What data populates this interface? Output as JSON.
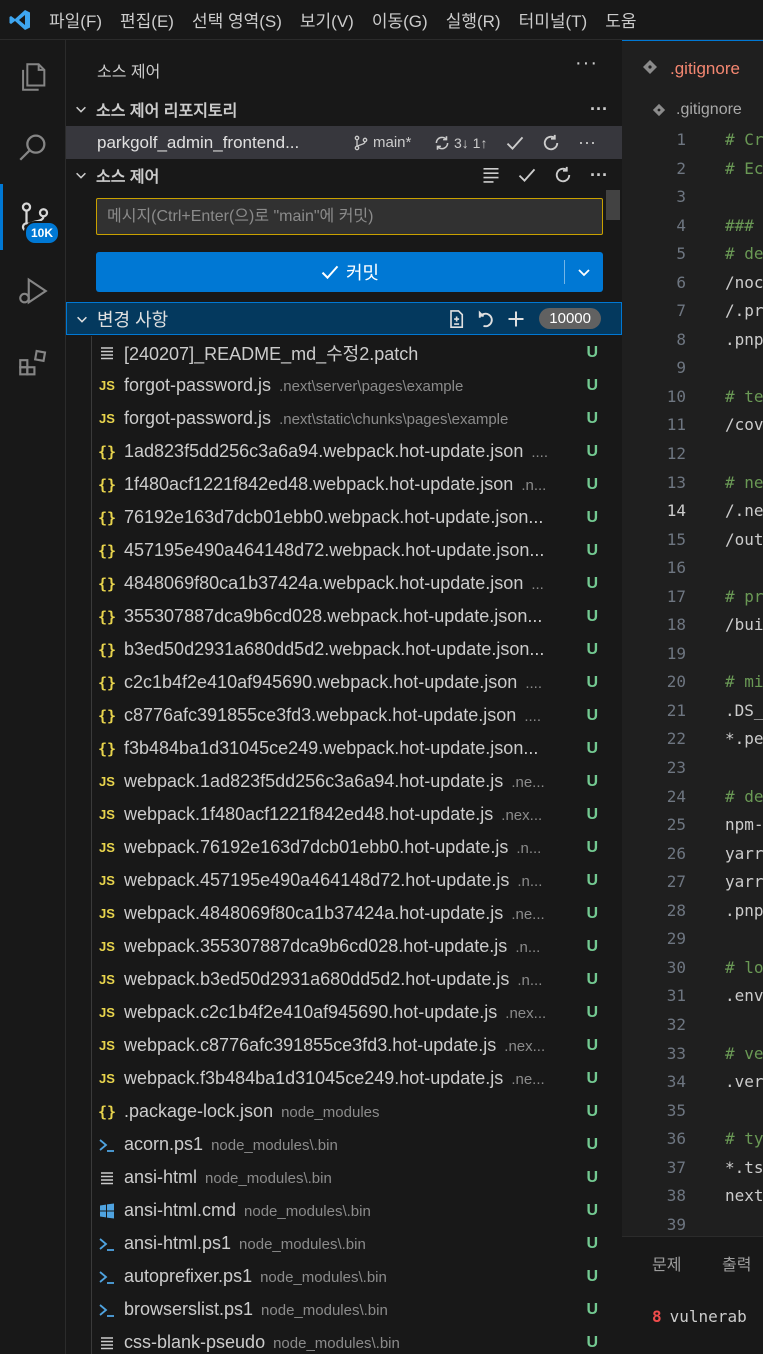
{
  "menubar": {
    "items": [
      "파일(F)",
      "편집(E)",
      "선택 영역(S)",
      "보기(V)",
      "이동(G)",
      "실행(R)",
      "터미널(T)",
      "도움"
    ]
  },
  "activity": {
    "badge": "10K",
    "accent": "#0078d4"
  },
  "sidebar": {
    "title": "소스 제어",
    "more": "···",
    "repos_header": "소스 제어 리포지토리",
    "repo": {
      "name": "parkgolf_admin_frontend...",
      "branch": "main*",
      "sync": "3↓ 1↑"
    },
    "scm_header": "소스 제어",
    "commit_placeholder": "메시지(Ctrl+Enter(으)로 \"main\"에 커밋)",
    "commit_label": "커밋",
    "changes_header": "변경 사항",
    "changes_count": "10000"
  },
  "files": [
    {
      "icon": "lines",
      "name": "[240207]_README_md_수정2.patch",
      "path": "",
      "status": "U"
    },
    {
      "icon": "js",
      "name": "forgot-password.js",
      "path": ".next\\server\\pages\\example",
      "status": "U"
    },
    {
      "icon": "js",
      "name": "forgot-password.js",
      "path": ".next\\static\\chunks\\pages\\example",
      "status": "U"
    },
    {
      "icon": "json",
      "name": "1ad823f5dd256c3a6a94.webpack.hot-update.json",
      "path": "....",
      "status": "U"
    },
    {
      "icon": "json",
      "name": "1f480acf1221f842ed48.webpack.hot-update.json",
      "path": ".n...",
      "status": "U"
    },
    {
      "icon": "json",
      "name": "76192e163d7dcb01ebb0.webpack.hot-update.json...",
      "path": "",
      "status": "U"
    },
    {
      "icon": "json",
      "name": "457195e490a464148d72.webpack.hot-update.json...",
      "path": "",
      "status": "U"
    },
    {
      "icon": "json",
      "name": "4848069f80ca1b37424a.webpack.hot-update.json",
      "path": "...",
      "status": "U"
    },
    {
      "icon": "json",
      "name": "355307887dca9b6cd028.webpack.hot-update.json...",
      "path": "",
      "status": "U"
    },
    {
      "icon": "json",
      "name": "b3ed50d2931a680dd5d2.webpack.hot-update.json...",
      "path": "",
      "status": "U"
    },
    {
      "icon": "json",
      "name": "c2c1b4f2e410af945690.webpack.hot-update.json",
      "path": "....",
      "status": "U"
    },
    {
      "icon": "json",
      "name": "c8776afc391855ce3fd3.webpack.hot-update.json",
      "path": "....",
      "status": "U"
    },
    {
      "icon": "json",
      "name": "f3b484ba1d31045ce249.webpack.hot-update.json...",
      "path": "",
      "status": "U"
    },
    {
      "icon": "js",
      "name": "webpack.1ad823f5dd256c3a6a94.hot-update.js",
      "path": ".ne...",
      "status": "U"
    },
    {
      "icon": "js",
      "name": "webpack.1f480acf1221f842ed48.hot-update.js",
      "path": ".nex...",
      "status": "U"
    },
    {
      "icon": "js",
      "name": "webpack.76192e163d7dcb01ebb0.hot-update.js",
      "path": ".n...",
      "status": "U"
    },
    {
      "icon": "js",
      "name": "webpack.457195e490a464148d72.hot-update.js",
      "path": ".n...",
      "status": "U"
    },
    {
      "icon": "js",
      "name": "webpack.4848069f80ca1b37424a.hot-update.js",
      "path": ".ne...",
      "status": "U"
    },
    {
      "icon": "js",
      "name": "webpack.355307887dca9b6cd028.hot-update.js",
      "path": ".n...",
      "status": "U"
    },
    {
      "icon": "js",
      "name": "webpack.b3ed50d2931a680dd5d2.hot-update.js",
      "path": ".n...",
      "status": "U"
    },
    {
      "icon": "js",
      "name": "webpack.c2c1b4f2e410af945690.hot-update.js",
      "path": ".nex...",
      "status": "U"
    },
    {
      "icon": "js",
      "name": "webpack.c8776afc391855ce3fd3.hot-update.js",
      "path": ".nex...",
      "status": "U"
    },
    {
      "icon": "js",
      "name": "webpack.f3b484ba1d31045ce249.hot-update.js",
      "path": ".ne...",
      "status": "U"
    },
    {
      "icon": "json",
      "name": ".package-lock.json",
      "path": "node_modules",
      "status": "U"
    },
    {
      "icon": "ps",
      "name": "acorn.ps1",
      "path": "node_modules\\.bin",
      "status": "U"
    },
    {
      "icon": "lines",
      "name": "ansi-html",
      "path": "node_modules\\.bin",
      "status": "U"
    },
    {
      "icon": "win",
      "name": "ansi-html.cmd",
      "path": "node_modules\\.bin",
      "status": "U"
    },
    {
      "icon": "ps",
      "name": "ansi-html.ps1",
      "path": "node_modules\\.bin",
      "status": "U"
    },
    {
      "icon": "ps",
      "name": "autoprefixer.ps1",
      "path": "node_modules\\.bin",
      "status": "U"
    },
    {
      "icon": "ps",
      "name": "browserslist.ps1",
      "path": "node_modules\\.bin",
      "status": "U"
    },
    {
      "icon": "lines",
      "name": "css-blank-pseudo",
      "path": "node_modules\\.bin",
      "status": "U"
    }
  ],
  "editor": {
    "tab": ".gitignore",
    "breadcrumb": ".gitignore",
    "current_line": 14,
    "lines": [
      {
        "n": "1",
        "text": "# Cr",
        "kind": "cmt"
      },
      {
        "n": "2",
        "text": "# Ec",
        "kind": "cmt"
      },
      {
        "n": "3",
        "text": "",
        "kind": "txt"
      },
      {
        "n": "4",
        "text": "###",
        "kind": "cmt"
      },
      {
        "n": "5",
        "text": "# de",
        "kind": "cmt"
      },
      {
        "n": "6",
        "text": "/noc",
        "kind": "txt"
      },
      {
        "n": "7",
        "text": "/.pr",
        "kind": "txt"
      },
      {
        "n": "8",
        "text": ".pnp",
        "kind": "txt"
      },
      {
        "n": "9",
        "text": "",
        "kind": "txt"
      },
      {
        "n": "10",
        "text": "# te",
        "kind": "cmt"
      },
      {
        "n": "11",
        "text": "/cov",
        "kind": "txt"
      },
      {
        "n": "12",
        "text": "",
        "kind": "txt"
      },
      {
        "n": "13",
        "text": "# ne",
        "kind": "cmt"
      },
      {
        "n": "14",
        "text": "/.ne",
        "kind": "txt"
      },
      {
        "n": "15",
        "text": "/out",
        "kind": "txt"
      },
      {
        "n": "16",
        "text": "",
        "kind": "txt"
      },
      {
        "n": "17",
        "text": "# pr",
        "kind": "cmt"
      },
      {
        "n": "18",
        "text": "/bui",
        "kind": "txt"
      },
      {
        "n": "19",
        "text": "",
        "kind": "txt"
      },
      {
        "n": "20",
        "text": "# mi",
        "kind": "cmt"
      },
      {
        "n": "21",
        "text": ".DS_",
        "kind": "txt"
      },
      {
        "n": "22",
        "text": "*.pe",
        "kind": "txt"
      },
      {
        "n": "23",
        "text": "",
        "kind": "txt"
      },
      {
        "n": "24",
        "text": "# de",
        "kind": "cmt"
      },
      {
        "n": "25",
        "text": "npm-",
        "kind": "txt"
      },
      {
        "n": "26",
        "text": "yarr",
        "kind": "txt"
      },
      {
        "n": "27",
        "text": "yarr",
        "kind": "txt"
      },
      {
        "n": "28",
        "text": ".pnp",
        "kind": "txt"
      },
      {
        "n": "29",
        "text": "",
        "kind": "txt"
      },
      {
        "n": "30",
        "text": "# lo",
        "kind": "cmt"
      },
      {
        "n": "31",
        "text": ".env",
        "kind": "txt"
      },
      {
        "n": "32",
        "text": "",
        "kind": "txt"
      },
      {
        "n": "33",
        "text": "# ve",
        "kind": "cmt"
      },
      {
        "n": "34",
        "text": ".ver",
        "kind": "txt"
      },
      {
        "n": "35",
        "text": "",
        "kind": "txt"
      },
      {
        "n": "36",
        "text": "# ty",
        "kind": "cmt"
      },
      {
        "n": "37",
        "text": "*.ts",
        "kind": "txt"
      },
      {
        "n": "38",
        "text": "next",
        "kind": "txt"
      },
      {
        "n": "39",
        "text": "",
        "kind": "txt"
      }
    ]
  },
  "panel": {
    "tabs": [
      "문제",
      "출력"
    ],
    "output_count": "8",
    "output_text": "vulnerab"
  }
}
